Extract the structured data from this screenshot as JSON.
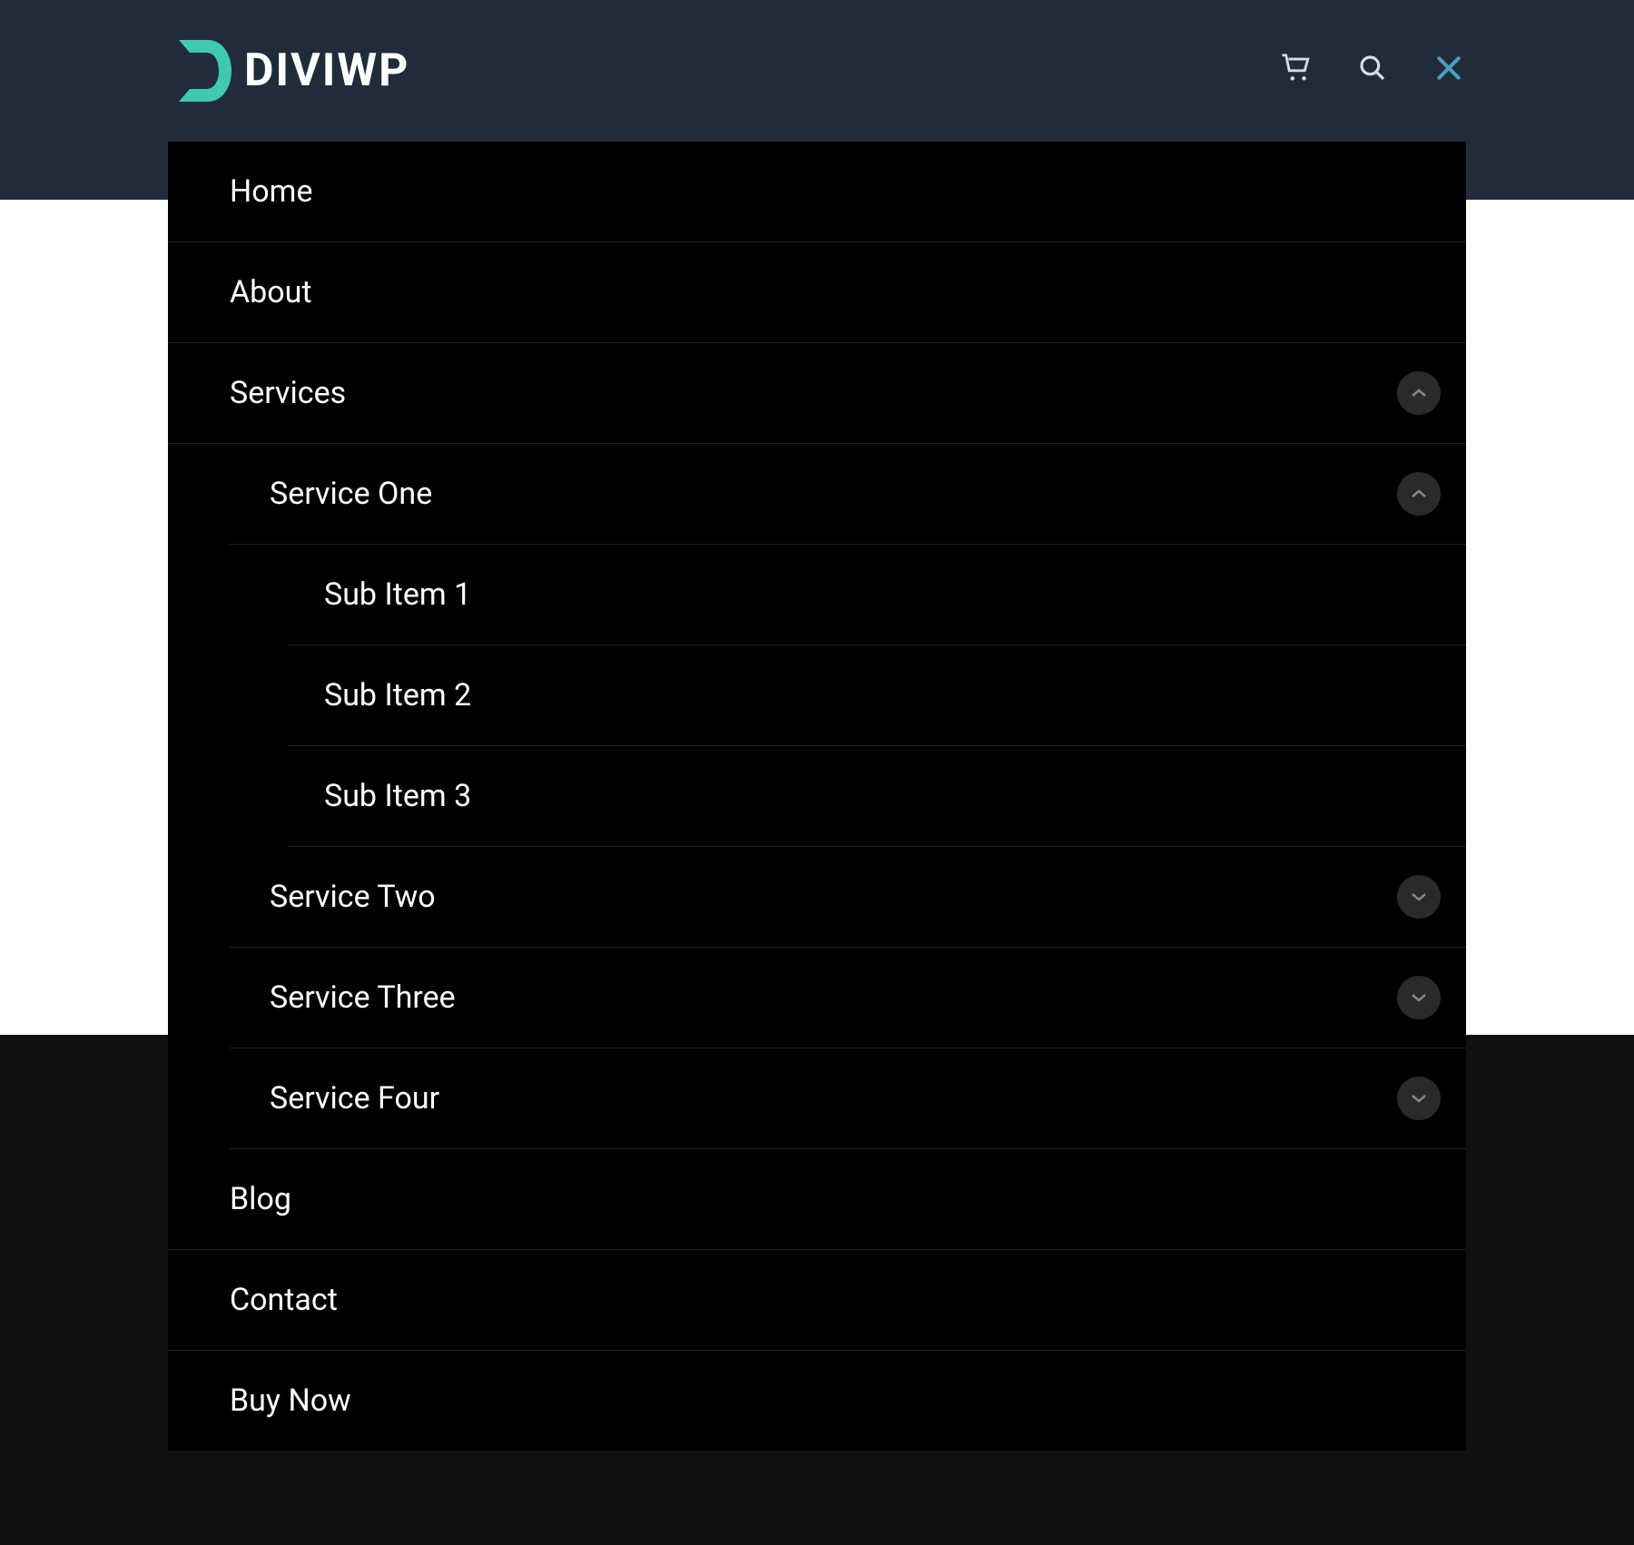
{
  "logo": {
    "text": "DIVIWP"
  },
  "nav": {
    "home": "Home",
    "about": "About",
    "services": {
      "label": "Services",
      "expanded": true,
      "items": {
        "service_one": {
          "label": "Service One",
          "expanded": true,
          "sub": [
            "Sub Item 1",
            "Sub Item 2",
            "Sub Item 3"
          ]
        },
        "service_two": {
          "label": "Service Two",
          "expanded": false
        },
        "service_three": {
          "label": "Service Three",
          "expanded": false
        },
        "service_four": {
          "label": "Service Four",
          "expanded": false
        }
      }
    },
    "blog": "Blog",
    "contact": "Contact",
    "buy_now": "Buy Now"
  },
  "icons": {
    "cart": "cart-icon",
    "search": "search-icon",
    "close": "close-icon"
  },
  "colors": {
    "accent": "#3fc9b0",
    "close_x": "#4a9fc1",
    "header_bg": "#202c3a"
  }
}
